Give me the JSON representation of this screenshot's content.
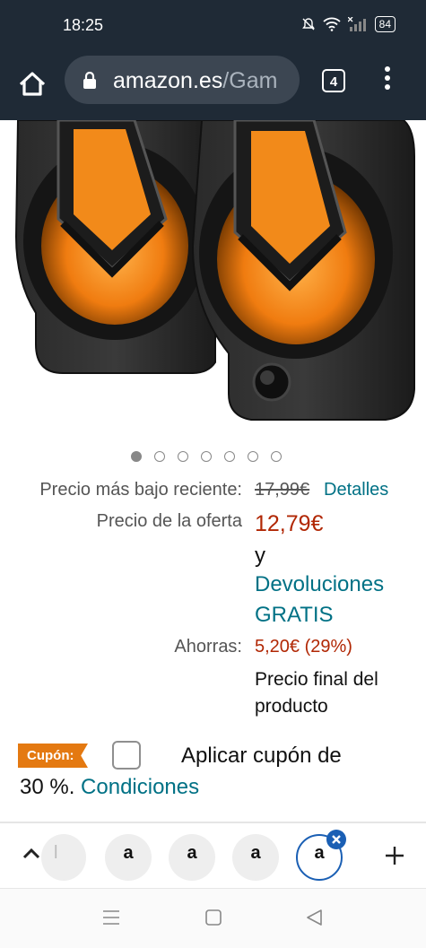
{
  "status_bar": {
    "time": "18:25",
    "battery": "84"
  },
  "browser": {
    "url_domain": "amazon.es",
    "url_path": "/Gam",
    "tab_count": "4"
  },
  "carousel": {
    "total": 7,
    "active_index": 0
  },
  "pricing": {
    "recent_low_label": "Precio más bajo reciente:",
    "recent_low_value": "17,99€",
    "details_link": "Detalles",
    "offer_label": "Precio de la oferta",
    "offer_price": "12,79€",
    "conjunction": "y",
    "returns_line1": "Devoluciones",
    "returns_line2": "GRATIS",
    "savings_label": "Ahorras:",
    "savings_value": "5,20€ (29%)",
    "final_line1": "Precio final del",
    "final_line2": "producto"
  },
  "coupon": {
    "badge": "Cupón:",
    "text_line1": "Aplicar cupón de",
    "text_line2": "30 %.",
    "conditions_link": "Condiciones"
  },
  "tabs": {
    "partial_glyph": "l",
    "tab_glyph": "a"
  },
  "colors": {
    "accent_red": "#b12704",
    "link_teal": "#007185",
    "coupon_orange": "#e47911",
    "chrome_dark": "#1f2a36"
  }
}
